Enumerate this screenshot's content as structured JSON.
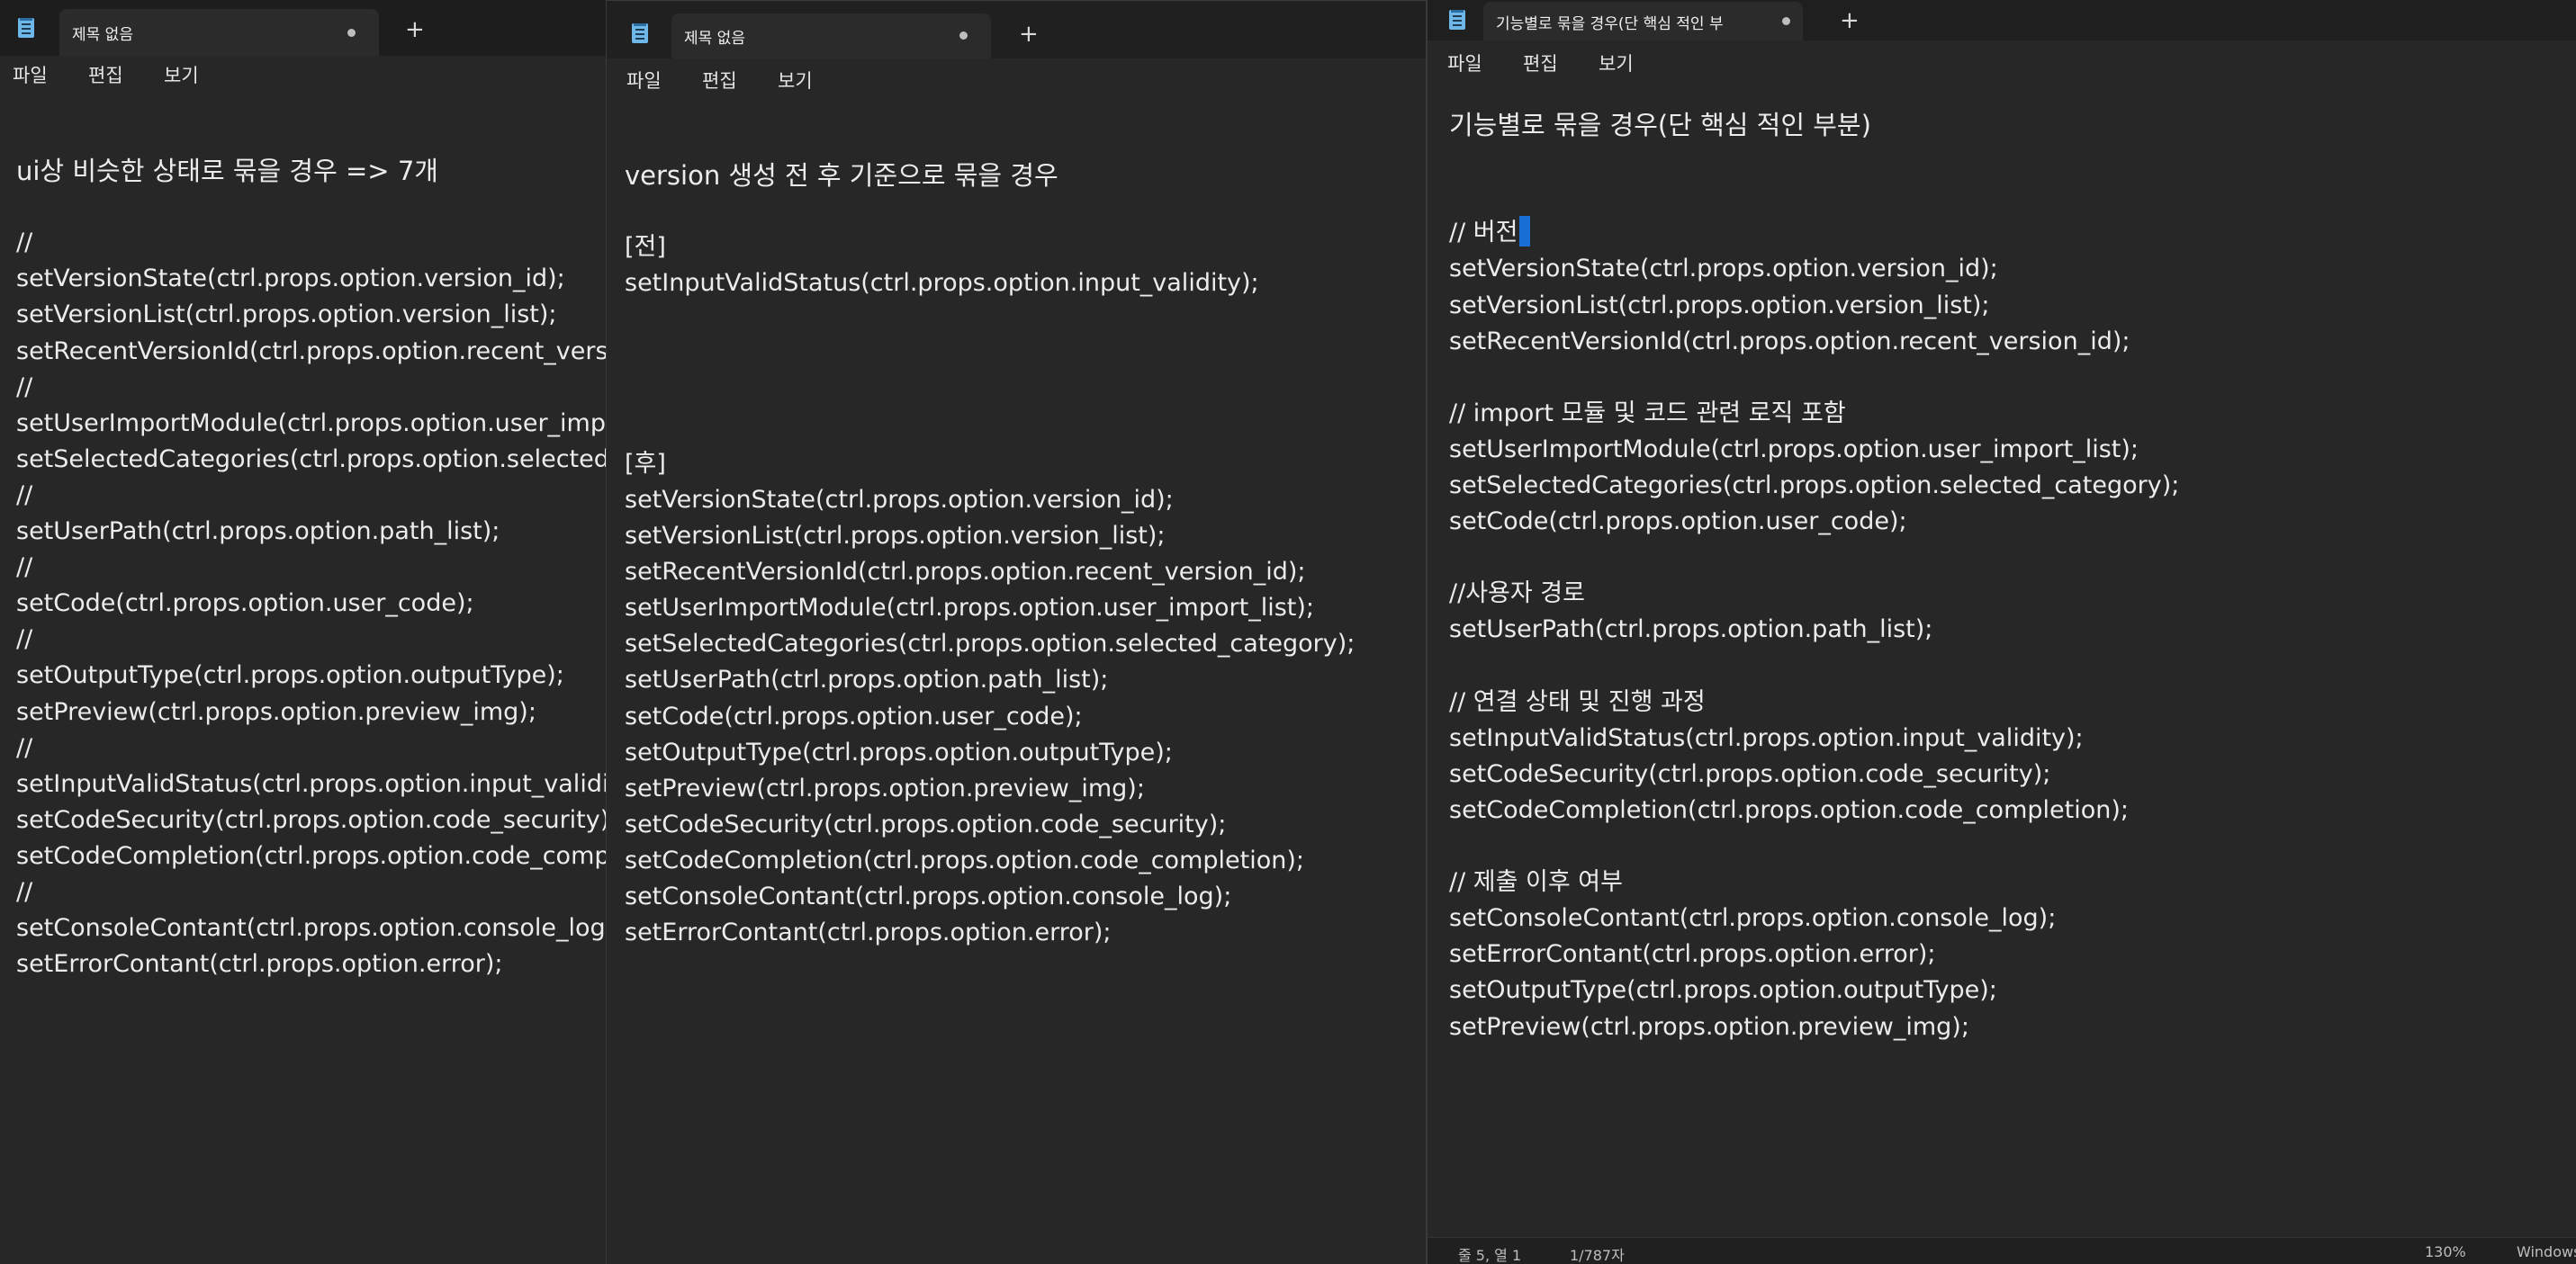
{
  "windows": [
    {
      "tab_title": "제목 없음",
      "menu": [
        "파일",
        "편집",
        "보기"
      ],
      "lines": [
        "ui상 비슷한 상태로 묶을 경우 => 7개",
        "",
        "//",
        "setVersionState(ctrl.props.option.version_id);",
        "setVersionList(ctrl.props.option.version_list);",
        "setRecentVersionId(ctrl.props.option.recent_version_id);",
        "//",
        "setUserImportModule(ctrl.props.option.user_import_list);",
        "setSelectedCategories(ctrl.props.option.selected_category);",
        "//",
        "setUserPath(ctrl.props.option.path_list);",
        "//",
        "setCode(ctrl.props.option.user_code);",
        "//",
        "setOutputType(ctrl.props.option.outputType);",
        "setPreview(ctrl.props.option.preview_img);",
        "//",
        "setInputValidStatus(ctrl.props.option.input_validity);",
        "setCodeSecurity(ctrl.props.option.code_security);",
        "setCodeCompletion(ctrl.props.option.code_completion);",
        "//",
        "setConsoleContant(ctrl.props.option.console_log);",
        "setErrorContant(ctrl.props.option.error);"
      ]
    },
    {
      "tab_title": "제목 없음",
      "menu": [
        "파일",
        "편집",
        "보기"
      ],
      "lines": [
        "version 생성 전 후 기준으로 묶을 경우",
        "",
        "[전]",
        "setInputValidStatus(ctrl.props.option.input_validity);",
        "",
        "",
        "",
        "",
        "[후]",
        "setVersionState(ctrl.props.option.version_id);",
        "setVersionList(ctrl.props.option.version_list);",
        "setRecentVersionId(ctrl.props.option.recent_version_id);",
        "setUserImportModule(ctrl.props.option.user_import_list);",
        "setSelectedCategories(ctrl.props.option.selected_category);",
        "setUserPath(ctrl.props.option.path_list);",
        "setCode(ctrl.props.option.user_code);",
        "setOutputType(ctrl.props.option.outputType);",
        "setPreview(ctrl.props.option.preview_img);",
        "setCodeSecurity(ctrl.props.option.code_security);",
        "setCodeCompletion(ctrl.props.option.code_completion);",
        "setConsoleContant(ctrl.props.option.console_log);",
        "setErrorContant(ctrl.props.option.error);"
      ]
    },
    {
      "tab_title": "기능별로 묶을 경우(단 핵심 적인 부",
      "menu": [
        "파일",
        "편집",
        "보기"
      ],
      "lines": [
        "기능별로 묶을 경우(단 핵심 적인 부분)",
        "",
        "",
        "// 버전",
        "setVersionState(ctrl.props.option.version_id);",
        "setVersionList(ctrl.props.option.version_list);",
        "setRecentVersionId(ctrl.props.option.recent_version_id);",
        "",
        "// import 모듈 및 코드 관련 로직 포함",
        "setUserImportModule(ctrl.props.option.user_import_list);",
        "setSelectedCategories(ctrl.props.option.selected_category);",
        "setCode(ctrl.props.option.user_code);",
        "",
        "//사용자 경로",
        "setUserPath(ctrl.props.option.path_list);",
        "",
        "// 연결 상태 및 진행 과정",
        "setInputValidStatus(ctrl.props.option.input_validity);",
        "setCodeSecurity(ctrl.props.option.code_security);",
        "setCodeCompletion(ctrl.props.option.code_completion);",
        "",
        "// 제출 이후 여부",
        "setConsoleContant(ctrl.props.option.console_log);",
        "setErrorContant(ctrl.props.option.error);",
        "setOutputType(ctrl.props.option.outputType);",
        "setPreview(ctrl.props.option.preview_img);"
      ],
      "status": {
        "position": "줄 5, 열 1",
        "chars": "1/787자",
        "zoom": "130%",
        "eol": "Windows"
      }
    }
  ],
  "colors": {
    "editor_bg": "#272727",
    "titlebar_bg": "#1d1d1d",
    "text": "#ececec",
    "selection": "#1a6fd6",
    "notepad_icon": "#6fb7e8"
  }
}
